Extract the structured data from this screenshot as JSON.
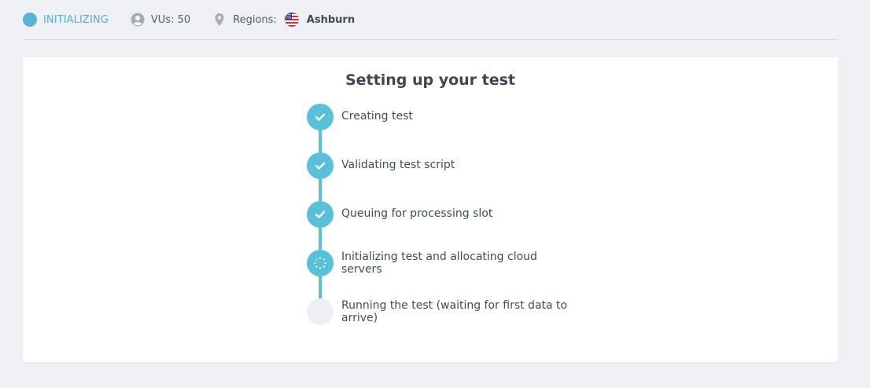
{
  "status": {
    "state": "INITIALIZING",
    "vus_label": "VUs: 50",
    "regions_label": "Regions:",
    "region": "Ashburn",
    "accent_color": "#58b4d4"
  },
  "card": {
    "title": "Setting up your test",
    "steps": [
      {
        "label": "Creating test",
        "state": "done",
        "icon": "check-icon"
      },
      {
        "label": "Validating test script",
        "state": "done",
        "icon": "check-icon"
      },
      {
        "label": "Queuing for processing slot",
        "state": "done",
        "icon": "check-icon"
      },
      {
        "label": "Initializing test and allocating cloud servers",
        "state": "in-progress",
        "icon": "spinner-icon"
      },
      {
        "label": "Running the test (waiting for first data to arrive)",
        "state": "pending",
        "icon": ""
      }
    ]
  }
}
